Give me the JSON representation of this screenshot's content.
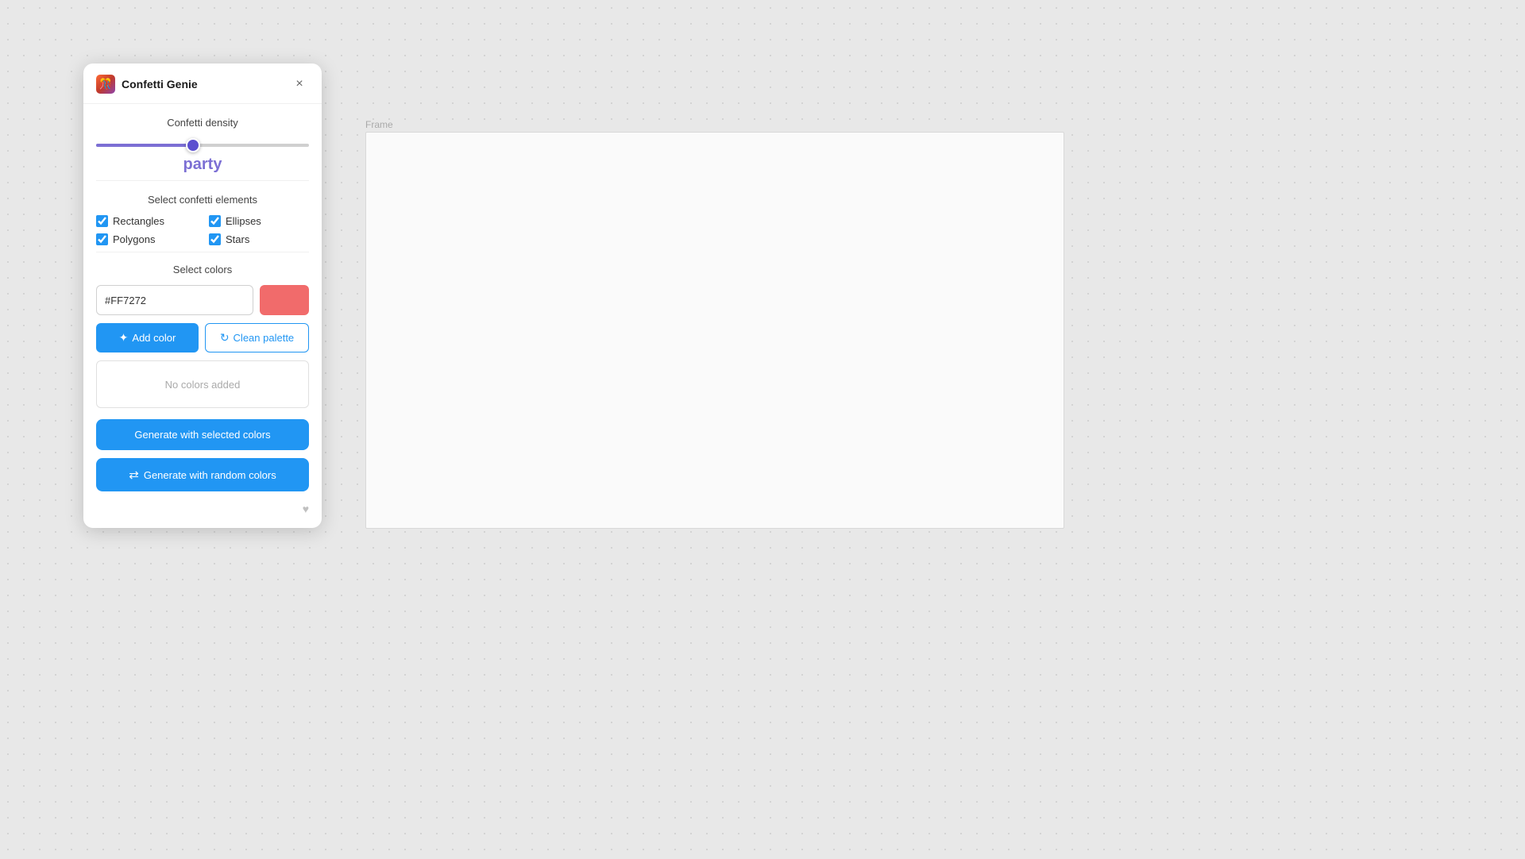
{
  "app": {
    "title": "Confetti Genie",
    "icon_label": "🎉"
  },
  "panel": {
    "close_label": "×",
    "density": {
      "section_label": "Confetti density",
      "slider_value": 45,
      "density_text": "party"
    },
    "elements": {
      "section_label": "Select confetti elements",
      "items": [
        {
          "label": "Rectangles",
          "checked": true
        },
        {
          "label": "Ellipses",
          "checked": true
        },
        {
          "label": "Polygons",
          "checked": true
        },
        {
          "label": "Stars",
          "checked": true
        }
      ]
    },
    "colors": {
      "section_label": "Select colors",
      "hex_value": "#FF7272",
      "hex_placeholder": "#FF7272",
      "swatch_color": "#f16b6b",
      "add_color_label": "Add color",
      "clean_palette_label": "Clean palette",
      "no_colors_text": "No colors added",
      "generate_selected_label": "Generate with selected colors",
      "generate_random_label": "Generate with random colors"
    }
  },
  "frame": {
    "label": "Frame"
  },
  "icons": {
    "plus": "✦",
    "refresh": "↻",
    "shuffle": "⇄",
    "heart": "♥"
  }
}
